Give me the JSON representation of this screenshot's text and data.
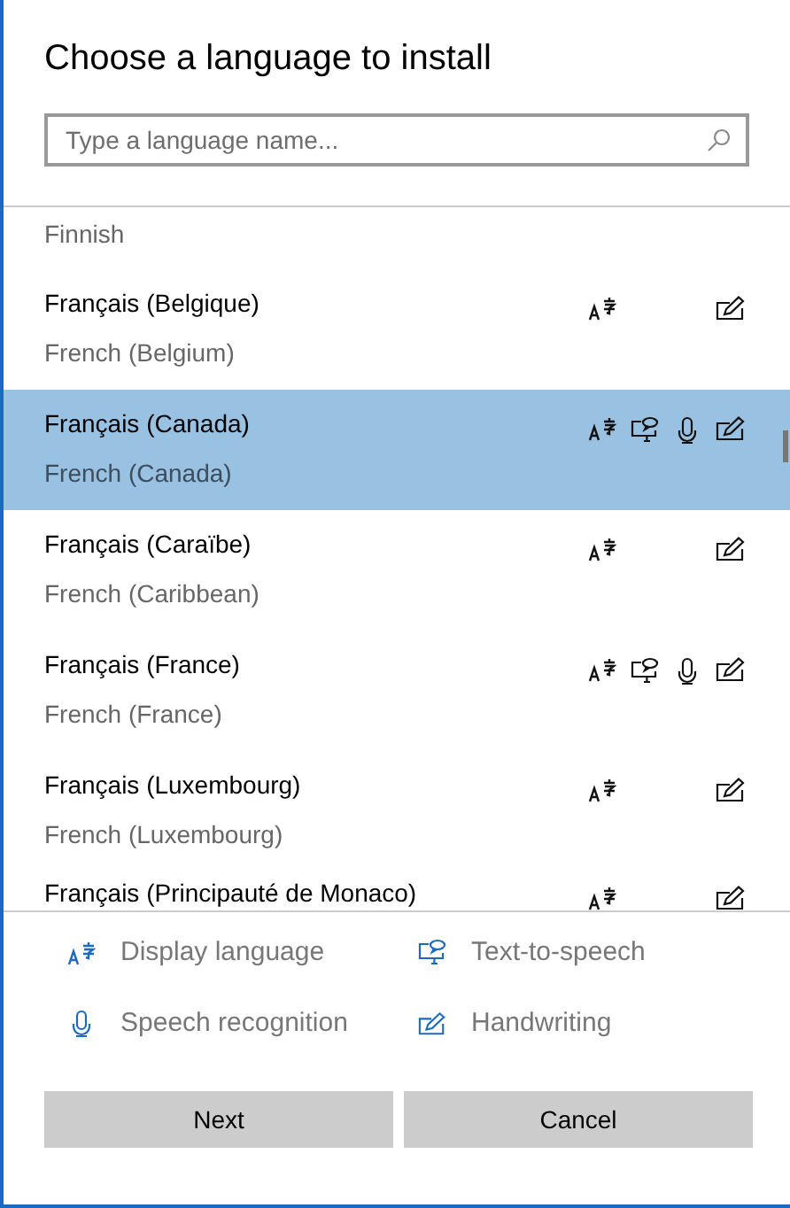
{
  "title": "Choose a language to install",
  "search": {
    "placeholder": "Type a language name..."
  },
  "languages": [
    {
      "secondary": "Finnish",
      "selected": false
    },
    {
      "primary": "Français (Belgique)",
      "secondary": "French (Belgium)",
      "display_language": true,
      "text_to_speech": false,
      "speech_recognition": false,
      "handwriting": true,
      "selected": false
    },
    {
      "primary": "Français (Canada)",
      "secondary": "French (Canada)",
      "display_language": true,
      "text_to_speech": true,
      "speech_recognition": true,
      "handwriting": true,
      "selected": true
    },
    {
      "primary": "Français (Caraïbe)",
      "secondary": "French (Caribbean)",
      "display_language": true,
      "text_to_speech": false,
      "speech_recognition": false,
      "handwriting": true,
      "selected": false
    },
    {
      "primary": "Français (France)",
      "secondary": "French (France)",
      "display_language": true,
      "text_to_speech": true,
      "speech_recognition": true,
      "handwriting": true,
      "selected": false
    },
    {
      "primary": "Français (Luxembourg)",
      "secondary": "French (Luxembourg)",
      "display_language": true,
      "text_to_speech": false,
      "speech_recognition": false,
      "handwriting": true,
      "selected": false
    },
    {
      "primary": "Français (Principauté de Monaco)",
      "display_language": true,
      "text_to_speech": false,
      "speech_recognition": false,
      "handwriting": true,
      "selected": false
    }
  ],
  "legend": [
    {
      "kind": "display_language",
      "label": "Display language"
    },
    {
      "kind": "text_to_speech",
      "label": "Text-to-speech"
    },
    {
      "kind": "speech_recognition",
      "label": "Speech recognition"
    },
    {
      "kind": "handwriting",
      "label": "Handwriting"
    }
  ],
  "buttons": [
    "Next",
    "Cancel"
  ]
}
